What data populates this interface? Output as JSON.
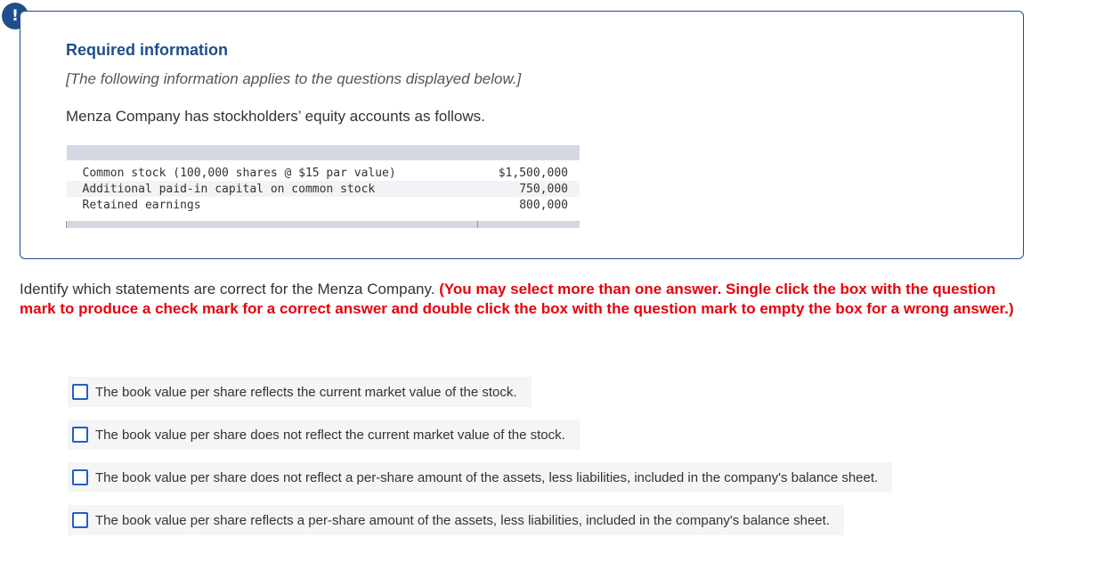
{
  "alert": {
    "symbol": "!"
  },
  "info": {
    "title": "Required information",
    "note": "[The following information applies to the questions displayed below.]",
    "description": "Menza Company has stockholders’ equity accounts as follows.",
    "table": [
      {
        "label": "Common stock (100,000 shares @ $15 par value)",
        "amount": "$1,500,000"
      },
      {
        "label": "Additional paid-in capital on common stock",
        "amount": "750,000"
      },
      {
        "label": "Retained earnings",
        "amount": "800,000"
      }
    ]
  },
  "question": {
    "prompt": "Identify which statements are correct for the Menza Company.",
    "instruction": "(You may select more than one answer. Single click the box with the question mark to produce a check mark for a correct answer and double click the box with the question mark to empty the box for a wrong answer.)"
  },
  "options": [
    {
      "text": "The book value per share reflects the current market value of the stock.",
      "checked": false
    },
    {
      "text": "The book value per share does not reflect the current market value of the stock.",
      "checked": false
    },
    {
      "text": "The book value per share does not reflect a per-share amount of the assets, less liabilities, included in the company's balance sheet.",
      "checked": false
    },
    {
      "text": "The book value per share reflects a per-share amount of the assets, less liabilities, included in the company's balance sheet.",
      "checked": false
    }
  ],
  "colors": {
    "accent": "#1f4e8c",
    "checkbox": "#1f5fc4",
    "instruction_red": "#e8000b"
  }
}
